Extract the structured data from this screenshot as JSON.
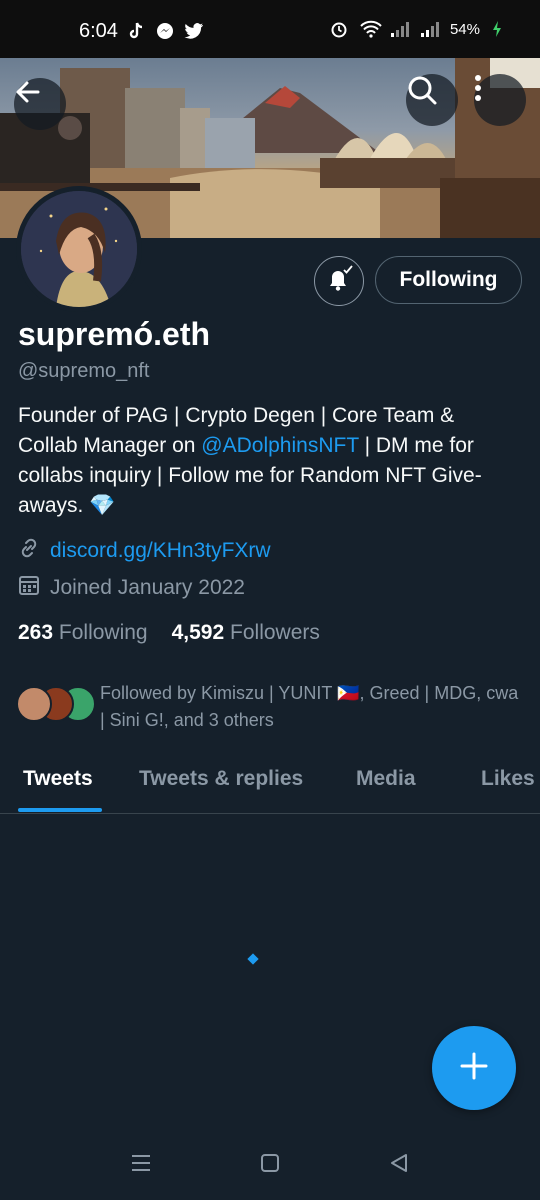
{
  "status_bar": {
    "time": "6:04",
    "app_icons": [
      "tiktok-icon",
      "messenger-icon",
      "twitter-icon"
    ],
    "right_icons": [
      "alarm-icon",
      "wifi-icon",
      "signal-icon",
      "signal-icon"
    ],
    "battery": "54%"
  },
  "header": {
    "back_icon": "arrow-left-icon",
    "search_icon": "search-icon",
    "more_icon": "more-vertical-icon"
  },
  "profile": {
    "display_name": "supremó.eth",
    "handle": "@supremo_nft",
    "bio_part1": "Founder of PAG | Crypto Degen | Core Team & Collab Manager on ",
    "bio_mention": "@ADolphinsNFT",
    "bio_part2": " | DM me for collabs inquiry | Follow me for Random NFT Give-aways. 💎",
    "link": "discord.gg/KHn3tyFXrw",
    "joined": "Joined January 2022",
    "following_count": "263",
    "following_label": "Following",
    "followers_count": "4,592",
    "followers_label": "Followers",
    "followed_by": "Followed by Kimiszu | YUNIT 🇵🇭, Greed | MDG, cwa | Sini G!, and 3 others"
  },
  "actions": {
    "notify_icon": "bell-check-icon",
    "following_button": "Following"
  },
  "tabs": [
    {
      "label": "Tweets",
      "active": true
    },
    {
      "label": "Tweets & replies",
      "active": false
    },
    {
      "label": "Media",
      "active": false
    },
    {
      "label": "Likes",
      "active": false
    }
  ],
  "fab_icon": "plus-icon",
  "colors": {
    "background": "#15202b",
    "accent": "#1d9bf0",
    "secondary_text": "#8b98a5",
    "border": "#38444d"
  }
}
